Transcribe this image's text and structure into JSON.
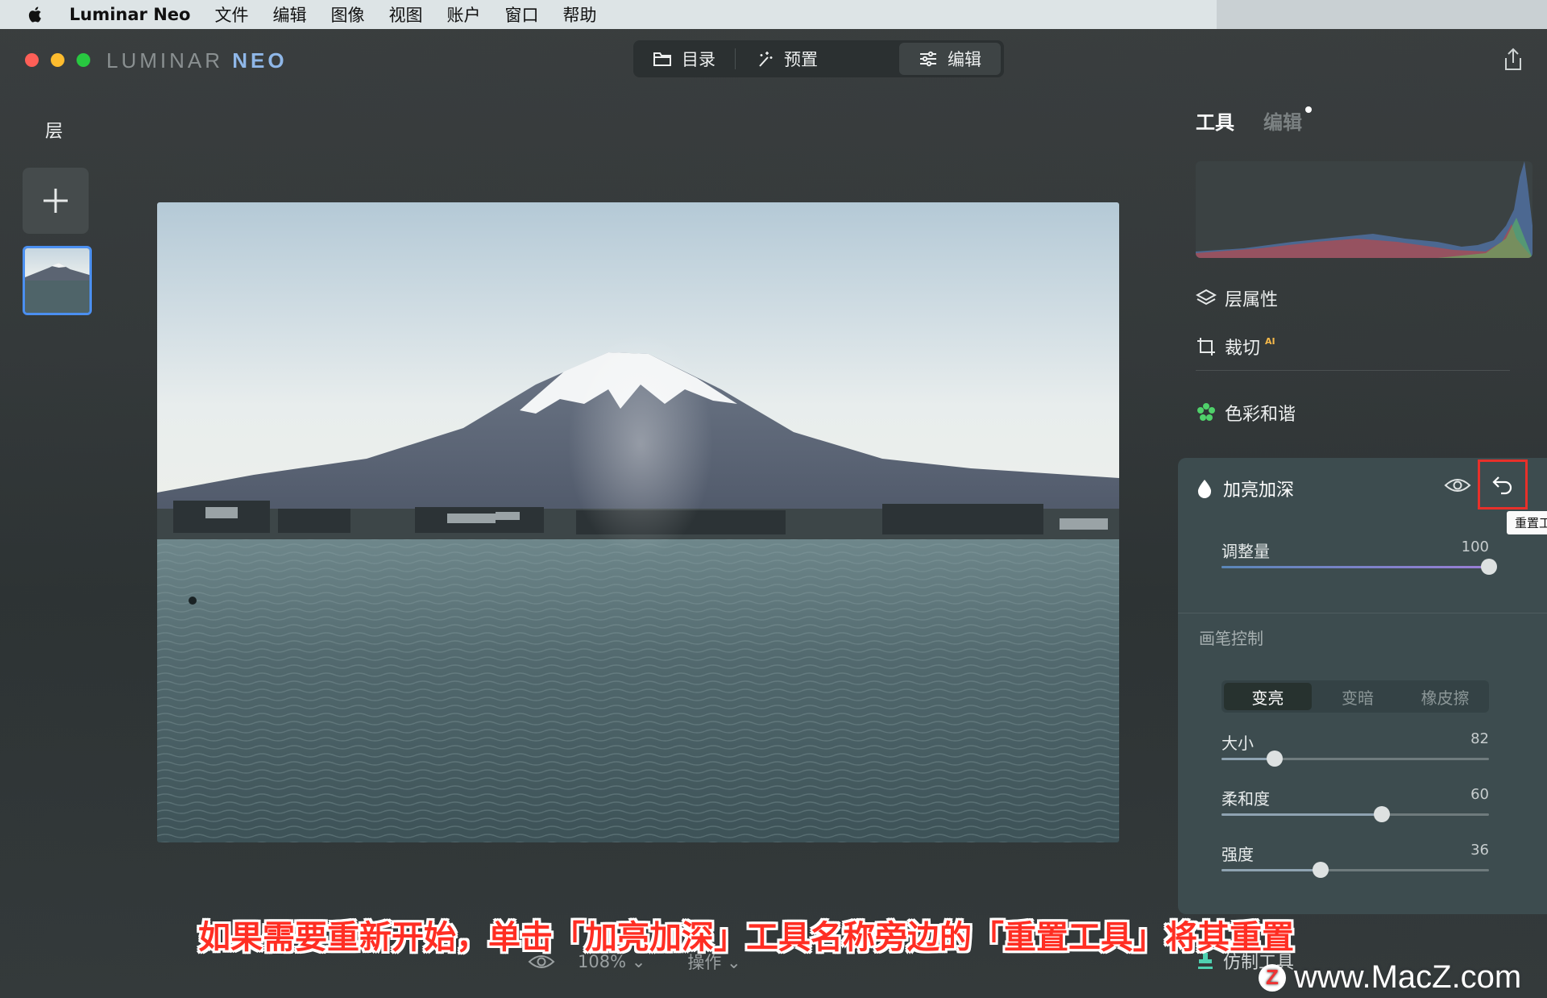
{
  "menubar": {
    "app_name": "Luminar Neo",
    "items": [
      "文件",
      "编辑",
      "图像",
      "视图",
      "账户",
      "窗口",
      "帮助"
    ]
  },
  "window": {
    "logo_luminar": "LUMINAR",
    "logo_neo": "NEO",
    "modes": [
      {
        "label": "目录",
        "icon": "folder-icon"
      },
      {
        "label": "预置",
        "icon": "magic-wand-icon"
      },
      {
        "label": "编辑",
        "icon": "sliders-icon",
        "active": true
      }
    ]
  },
  "layers": {
    "title": "层"
  },
  "bottom_bar": {
    "zoom": "108%",
    "actions": "操作"
  },
  "panel": {
    "tabs": {
      "tools": "工具",
      "edits": "编辑"
    },
    "rows": {
      "layer_properties": "层属性",
      "crop": "裁切",
      "crop_badge": "AI",
      "color_harmony": "色彩和谐",
      "clone": "仿制工具"
    },
    "dodge_burn": {
      "title": "加亮加深",
      "tooltip": "重置工具",
      "amount": {
        "label": "调整量",
        "value": "100",
        "fraction": 1.0
      },
      "brush_control_label": "画笔控制",
      "modes": [
        "变亮",
        "变暗",
        "橡皮擦"
      ],
      "active_mode": 0,
      "size": {
        "label": "大小",
        "value": "82",
        "fraction": 0.2
      },
      "softness": {
        "label": "柔和度",
        "value": "60",
        "fraction": 0.6
      },
      "strength": {
        "label": "强度",
        "value": "36",
        "fraction": 0.37
      }
    }
  },
  "colors": {
    "accent_blue": "#4b8ff0",
    "highlight_red": "#e8302a",
    "harmony_green": "#4fd06a",
    "amount_purple": "#9a7ed6"
  },
  "caption": "如果需要重新开始，单击「加亮加深」工具名称旁边的「重置工具」将其重置",
  "watermark": "www.MacZ.com"
}
